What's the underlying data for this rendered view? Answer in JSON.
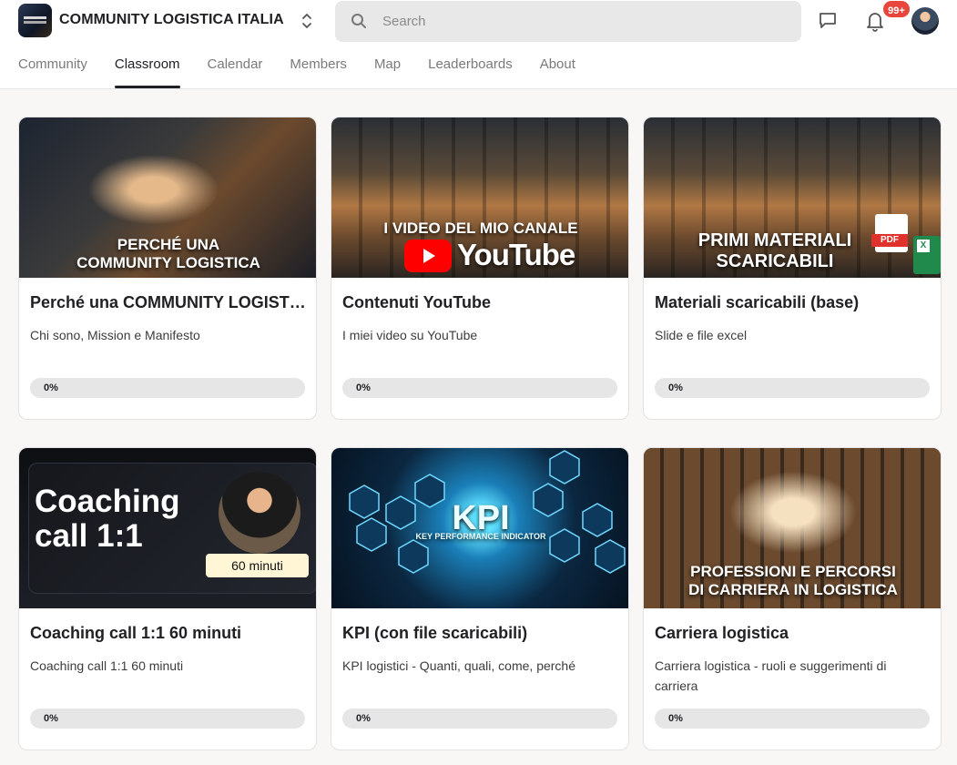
{
  "header": {
    "brand": "COMMUNITY LOGISTICA ITALIA",
    "search_placeholder": "Search",
    "notifications_badge": "99+"
  },
  "nav": {
    "tabs": [
      {
        "label": "Community",
        "active": false
      },
      {
        "label": "Classroom",
        "active": true
      },
      {
        "label": "Calendar",
        "active": false
      },
      {
        "label": "Members",
        "active": false
      },
      {
        "label": "Map",
        "active": false
      },
      {
        "label": "Leaderboards",
        "active": false
      },
      {
        "label": "About",
        "active": false
      }
    ]
  },
  "courses": [
    {
      "thumb_text": "PERCHÉ UNA\nCOMMUNITY LOGISTICA",
      "title": "Perché una COMMUNITY LOGISTICA ITALIA",
      "description": "Chi sono, Mission e Manifesto",
      "progress": 0,
      "progress_label": "0%"
    },
    {
      "thumb_text": "I VIDEO DEL MIO CANALE",
      "thumb_brand": "YouTube",
      "title": "Contenuti YouTube",
      "description": "I miei video su YouTube",
      "progress": 0,
      "progress_label": "0%"
    },
    {
      "thumb_text": "PRIMI MATERIALI\nSCARICABILI",
      "thumb_file_badge": "PDF",
      "thumb_sheet_badge": "X",
      "title": "Materiali scaricabili (base)",
      "description": "Slide e file excel",
      "progress": 0,
      "progress_label": "0%"
    },
    {
      "thumb_text": "Coaching\ncall 1:1",
      "thumb_duration": "60 minuti",
      "title": "Coaching call 1:1 60 minuti",
      "description": "Coaching call 1:1 60 minuti",
      "progress": 0,
      "progress_label": "0%"
    },
    {
      "thumb_text": "KPI",
      "thumb_subtext": "KEY PERFORMANCE INDICATOR",
      "title": "KPI (con file scaricabili)",
      "description": "KPI logistici - Quanti, quali, come, perché",
      "progress": 0,
      "progress_label": "0%"
    },
    {
      "thumb_text": "PROFESSIONI E PERCORSI\nDI CARRIERA IN LOGISTICA",
      "title": "Carriera logistica",
      "description": "Carriera logistica - ruoli e suggerimenti di carriera",
      "progress": 0,
      "progress_label": "0%"
    }
  ],
  "colors": {
    "accent": "#202124",
    "badge": "#e8453c",
    "progress_track": "#e6e6e6",
    "youtube_red": "#ff0000"
  }
}
